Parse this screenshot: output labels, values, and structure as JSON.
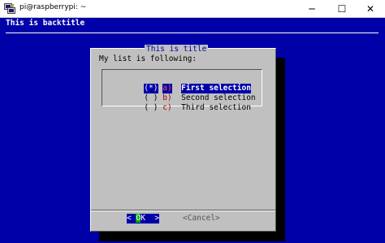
{
  "window": {
    "title": "pi@raspberrypi: ~",
    "minimize": "─",
    "maximize": "☐",
    "close": "✕"
  },
  "terminal": {
    "backtitle": "This is backtitle"
  },
  "dialog": {
    "title": "This is title",
    "prompt": "My list is following:",
    "items": [
      {
        "radio": "(*)",
        "tag": "a)",
        "label": "First selection",
        "selected": true
      },
      {
        "radio": "( )",
        "tag": "b)",
        "label": "Second selection",
        "selected": false
      },
      {
        "radio": "( )",
        "tag": "c)",
        "label": "Third selection",
        "selected": false
      }
    ],
    "ok": {
      "left": "< ",
      "hot": "O",
      "rest": "K",
      "right": "  >"
    },
    "cancel": "<Cancel>"
  },
  "colors": {
    "terminal_bg": "#0000a8",
    "dialog_bg": "#c0c0c0",
    "highlight": "#0000a8",
    "tag_red": "#a80000",
    "hotkey_green": "#00a800"
  }
}
